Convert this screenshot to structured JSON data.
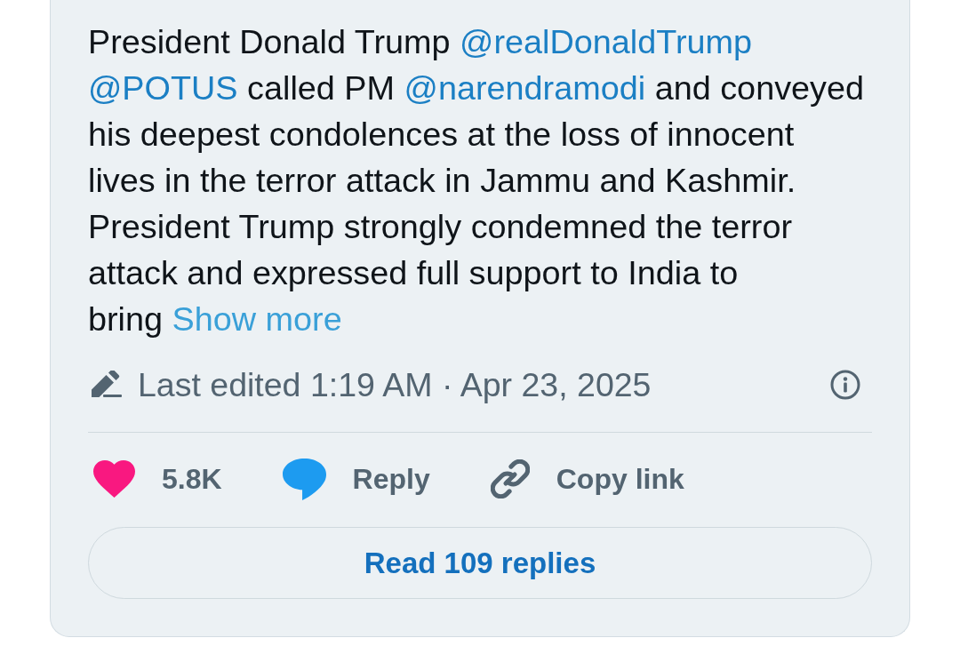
{
  "tweet": {
    "text": [
      {
        "kind": "text",
        "text": "President Donald Trump"
      },
      {
        "kind": "mention",
        "text": "@realDonaldTrump"
      },
      {
        "kind": "mention",
        "text": "@POTUS"
      },
      {
        "kind": "text",
        "text": "called PM"
      },
      {
        "kind": "mention",
        "text": "@narendramodi"
      },
      {
        "kind": "text",
        "text": "and conveyed his deepest condolences at the loss of innocent lives in the terror attack in Jammu and Kashmir. President Trump strongly condemned the terror attack and expressed full support to India to bring"
      },
      {
        "kind": "more",
        "text": "Show more"
      }
    ],
    "edited": "Last edited 1:19 AM · Apr 23, 2025",
    "actions": [
      {
        "kind": "like",
        "label": "5.8K"
      },
      {
        "kind": "reply",
        "label": "Reply"
      },
      {
        "kind": "copy",
        "label": "Copy link"
      }
    ],
    "read_replies": "Read 109 replies"
  }
}
